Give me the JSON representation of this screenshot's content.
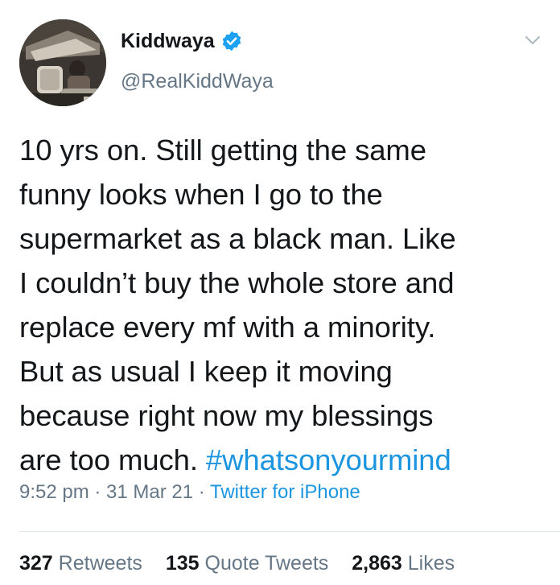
{
  "profile": {
    "display_name": "Kiddwaya",
    "handle": "@RealKiddWaya",
    "verified_icon": "verified-badge-icon",
    "accent_color": "#1da1f2"
  },
  "tweet": {
    "lines": [
      "10 yrs on. Still getting the same",
      "funny looks when I go to the",
      "supermarket as a black man. Like",
      "I couldn’t buy the whole store and",
      "replace every mf with a minority.",
      "But as usual I keep it moving",
      "because right now my blessings"
    ],
    "last_line_text": "are too much. ",
    "hashtag": "#whatsonyourmind",
    "hashtag_color": "#1b95e0"
  },
  "meta": {
    "time": "9:52 pm",
    "separator": " · ",
    "date": "31 Mar 21",
    "source": "Twitter for iPhone"
  },
  "stats": {
    "retweets_count": "327",
    "retweets_label": "Retweets",
    "quotes_count": "135",
    "quotes_label": "Quote Tweets",
    "likes_count": "2,863",
    "likes_label": "Likes"
  }
}
